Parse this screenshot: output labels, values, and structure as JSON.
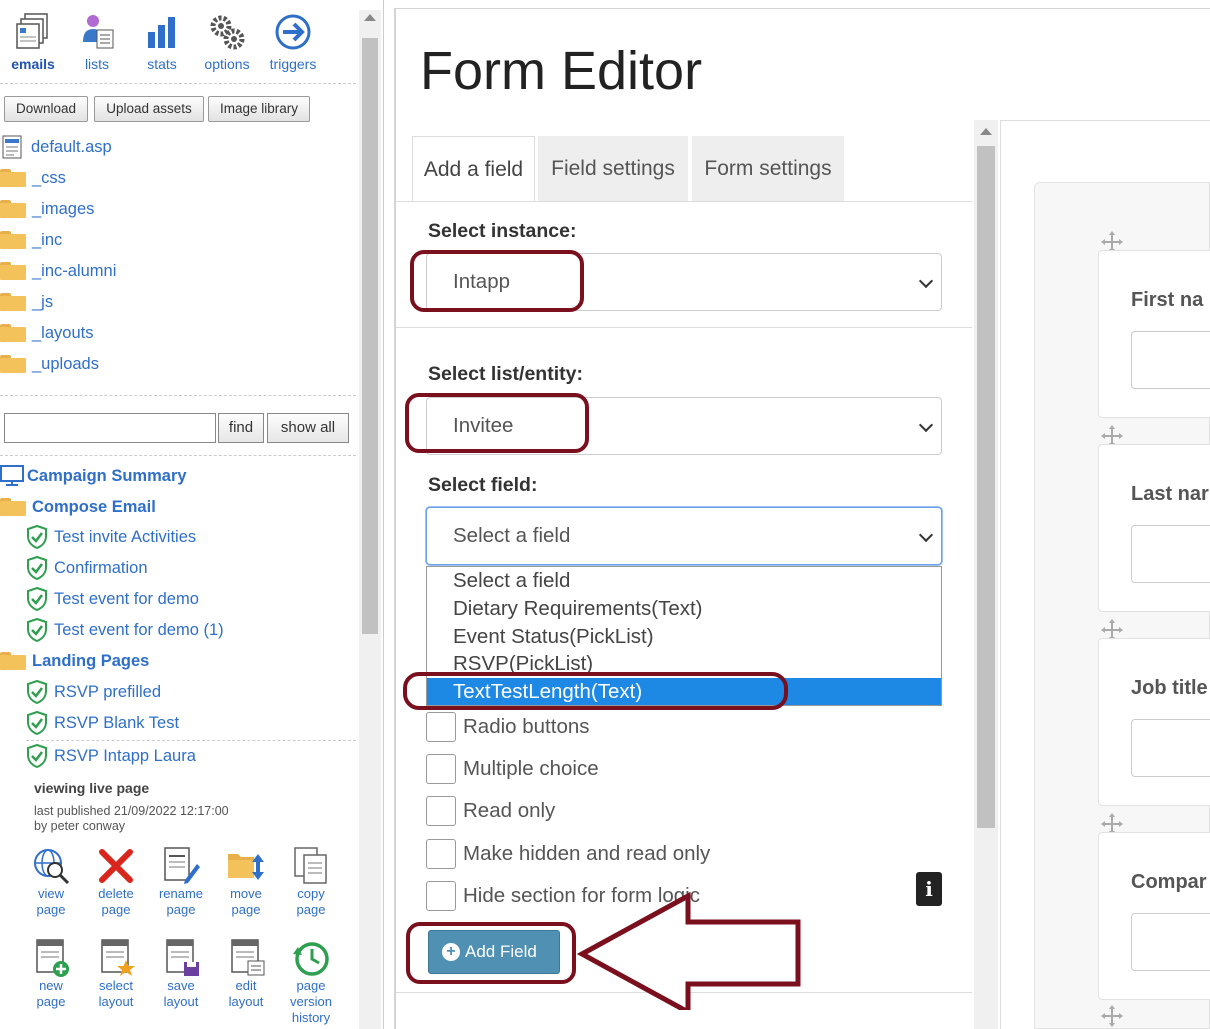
{
  "topnav": [
    {
      "label": "emails",
      "icon": "emails-icon",
      "active": true
    },
    {
      "label": "lists",
      "icon": "lists-icon"
    },
    {
      "label": "stats",
      "icon": "stats-icon"
    },
    {
      "label": "options",
      "icon": "options-icon"
    },
    {
      "label": "triggers",
      "icon": "triggers-icon"
    }
  ],
  "asset_buttons": [
    "Download",
    "Upload assets",
    "Image library"
  ],
  "files": [
    {
      "label": "default.asp",
      "type": "file"
    },
    {
      "label": "_css",
      "type": "folder"
    },
    {
      "label": "_images",
      "type": "folder"
    },
    {
      "label": "_inc",
      "type": "folder"
    },
    {
      "label": "_inc-alumni",
      "type": "folder"
    },
    {
      "label": "_js",
      "type": "folder"
    },
    {
      "label": "_layouts",
      "type": "folder"
    },
    {
      "label": "_uploads",
      "type": "folder"
    }
  ],
  "search": {
    "value": "",
    "find_label": "find",
    "show_all_label": "show all"
  },
  "campaign": {
    "summary": "Campaign Summary",
    "compose": "Compose Email",
    "emails": [
      "Test invite Activities",
      "Confirmation",
      "Test event for demo",
      "Test event for demo (1)"
    ],
    "landing": "Landing Pages",
    "pages": [
      "RSVP prefilled",
      "RSVP Blank Test",
      "RSVP Intapp Laura"
    ]
  },
  "viewing": "viewing  live  page",
  "published": "last published 21/09/2022 12:17:00",
  "published_by": "by peter conway",
  "page_actions": [
    {
      "l1": "view",
      "l2": "page",
      "icon": "view-page-icon"
    },
    {
      "l1": "delete",
      "l2": "page",
      "icon": "delete-page-icon"
    },
    {
      "l1": "rename",
      "l2": "page",
      "icon": "rename-page-icon"
    },
    {
      "l1": "move",
      "l2": "page",
      "icon": "move-page-icon"
    },
    {
      "l1": "copy",
      "l2": "page",
      "icon": "copy-page-icon"
    }
  ],
  "layout_actions": [
    {
      "l1": "new",
      "l2": "page",
      "l3": "",
      "icon": "new-page-icon"
    },
    {
      "l1": "select",
      "l2": "layout",
      "l3": "",
      "icon": "select-layout-icon"
    },
    {
      "l1": "save",
      "l2": "layout",
      "l3": "",
      "icon": "save-layout-icon"
    },
    {
      "l1": "edit",
      "l2": "layout",
      "l3": "",
      "icon": "edit-layout-icon"
    },
    {
      "l1": "page",
      "l2": "version",
      "l3": "history",
      "icon": "page-version-history-icon"
    }
  ],
  "editor": {
    "title": "Form Editor",
    "tabs": [
      "Add a field",
      "Field settings",
      "Form settings"
    ],
    "instance_label": "Select instance:",
    "instance_value": "Intapp",
    "entity_label": "Select list/entity:",
    "entity_value": "Invitee",
    "field_label": "Select field:",
    "field_value": "Select a field",
    "field_options": [
      "Select a field",
      "Dietary Requirements(Text)",
      "Event Status(PickList)",
      "RSVP(PickList)",
      "TextTestLength(Text)"
    ],
    "selected_option": "TextTestLength(Text)",
    "checkboxes": [
      "Radio buttons",
      "Multiple choice",
      "Read only",
      "Make hidden and read only",
      "Hide section for form logic"
    ],
    "add_button": "Add Field",
    "info_glyph": "i"
  },
  "preview": {
    "fields": [
      "First na",
      "Last nar",
      "Job title",
      "Compar"
    ]
  },
  "colors": {
    "link": "#2f6fc9",
    "annotation": "#7a0f1e",
    "selected_option": "#1e88e5",
    "add_button": "#4f90b3"
  }
}
